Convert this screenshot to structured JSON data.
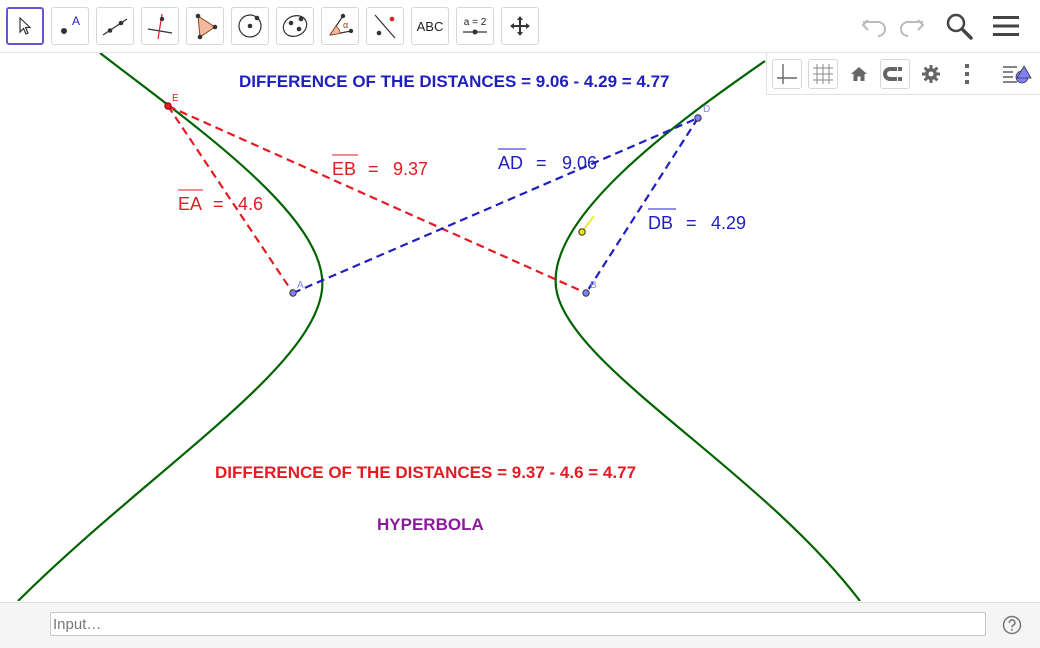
{
  "toolbar": {
    "tools": [
      {
        "name": "move",
        "label": ""
      },
      {
        "name": "point",
        "label": "A"
      },
      {
        "name": "line",
        "label": ""
      },
      {
        "name": "perpendicular-line",
        "label": ""
      },
      {
        "name": "polygon",
        "label": ""
      },
      {
        "name": "circle",
        "label": ""
      },
      {
        "name": "ellipse",
        "label": ""
      },
      {
        "name": "angle",
        "label": "α"
      },
      {
        "name": "reflect",
        "label": ""
      },
      {
        "name": "text",
        "label": "ABC"
      },
      {
        "name": "slider",
        "label": "a = 2"
      },
      {
        "name": "move-graphics",
        "label": ""
      }
    ]
  },
  "stylebar": {
    "items": [
      "toggle-axes",
      "toggle-grid",
      "standard-view",
      "point-capturing",
      "settings",
      "more",
      "toggle-stylebar"
    ]
  },
  "graphics": {
    "title_blue": "DIFFERENCE OF THE DISTANCES = 9.06 - 4.29 = 4.77",
    "title_red": "DIFFERENCE OF THE DISTANCES = 9.37 - 4.6 = 4.77",
    "caption": "HYPERBOLA",
    "points": {
      "A": "A",
      "B": "B",
      "D": "D",
      "E": "E"
    },
    "segments": {
      "EA": {
        "name": "EA",
        "value": "4.6"
      },
      "EB": {
        "name": "EB",
        "value": "9.37"
      },
      "AD": {
        "name": "AD",
        "value": "9.06"
      },
      "DB": {
        "name": "DB",
        "value": "4.29"
      }
    },
    "equals": "=",
    "colors": {
      "blue": "#1f1fbf",
      "red": "#e31b23",
      "green": "#006400",
      "purple": "#8b1a9c",
      "point": "#8080ff"
    }
  },
  "inputbar": {
    "placeholder": "Input…"
  }
}
